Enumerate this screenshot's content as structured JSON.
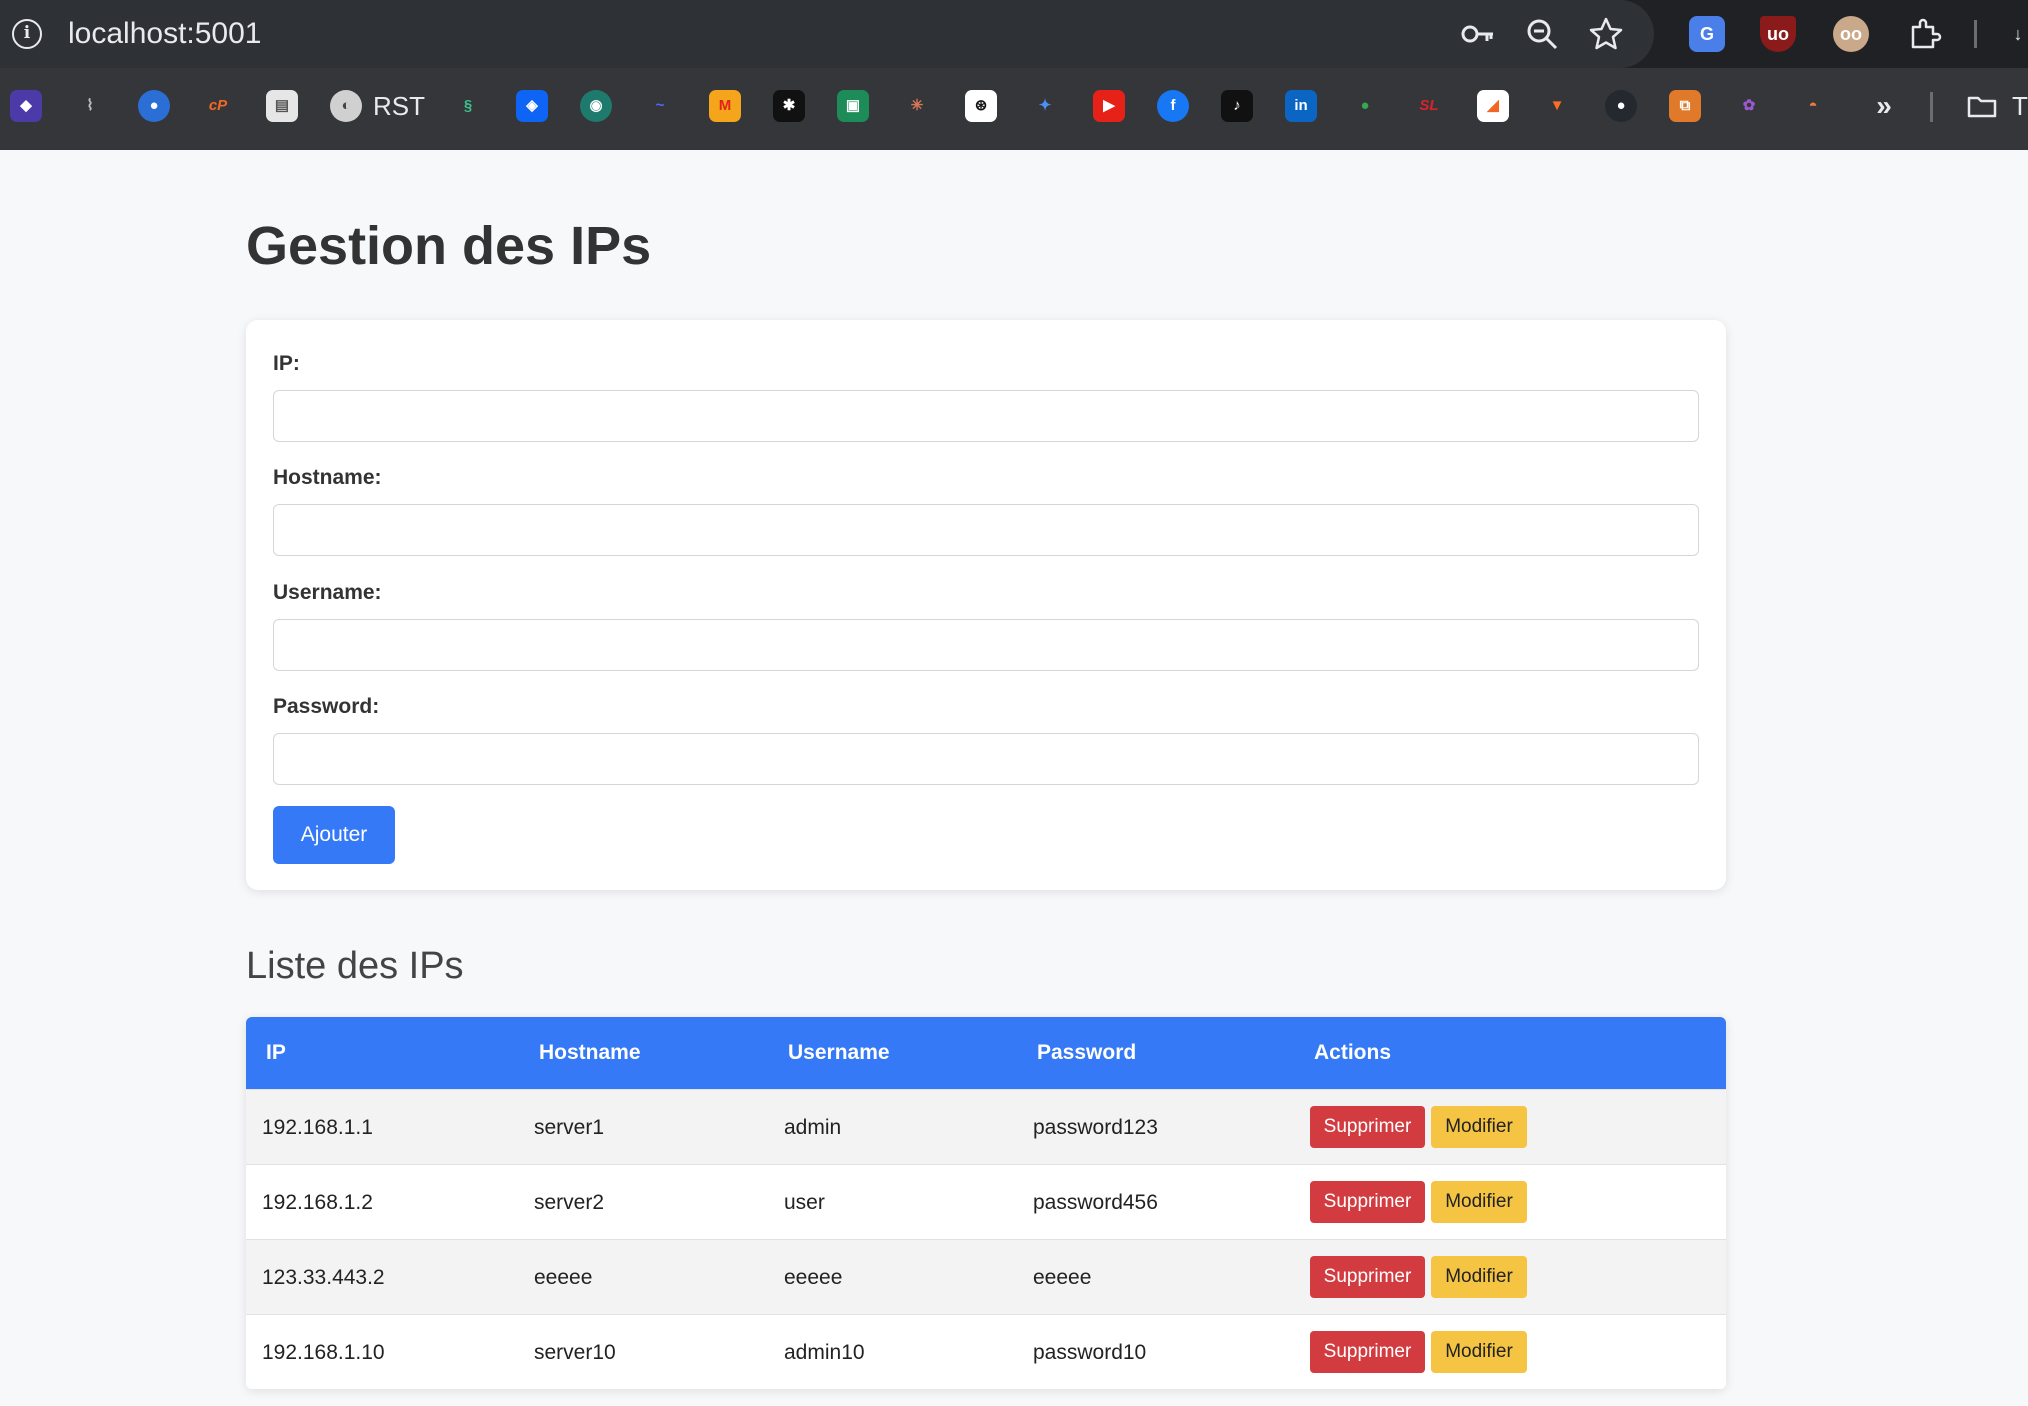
{
  "browser": {
    "url": "localhost:5001",
    "omnibox_icons": [
      "site-info-icon",
      "key-icon",
      "zoom-icon",
      "star-icon"
    ],
    "extensions": [
      "translate-extension",
      "ublock-extension",
      "privacy-extension",
      "puzzle-icon"
    ],
    "bookmarks": {
      "rst_label": "RST",
      "sl_label": "SL",
      "overflow_label": "»",
      "folder_label": "T"
    }
  },
  "page": {
    "title": "Gestion des IPs",
    "form": {
      "ip_label": "IP:",
      "hostname_label": "Hostname:",
      "username_label": "Username:",
      "password_label": "Password:",
      "ip_value": "",
      "hostname_value": "",
      "username_value": "",
      "password_value": "",
      "submit_label": "Ajouter"
    },
    "list_title": "Liste des IPs",
    "table": {
      "headers": [
        "IP",
        "Hostname",
        "Username",
        "Password",
        "Actions"
      ],
      "rows": [
        {
          "ip": "192.168.1.1",
          "hostname": "server1",
          "username": "admin",
          "password": "password123"
        },
        {
          "ip": "192.168.1.2",
          "hostname": "server2",
          "username": "user",
          "password": "password456"
        },
        {
          "ip": "123.33.443.2",
          "hostname": "eeeee",
          "username": "eeeee",
          "password": "eeeee"
        },
        {
          "ip": "192.168.1.10",
          "hostname": "server10",
          "username": "admin10",
          "password": "password10"
        }
      ],
      "delete_label": "Supprimer",
      "edit_label": "Modifier"
    }
  },
  "colors": {
    "primary": "#3579f6",
    "danger": "#d23c40",
    "warning": "#f5c443"
  }
}
